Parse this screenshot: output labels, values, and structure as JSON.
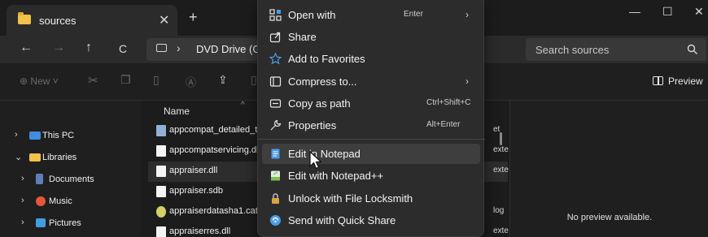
{
  "window": {
    "tab_title": "sources",
    "tab_close": "✕",
    "new_tab": "+",
    "minimize": "—",
    "maximize": "☐",
    "close": "✕"
  },
  "navigation": {
    "back": "←",
    "forward": "→",
    "up": "↑",
    "refresh": "C",
    "separator": "›",
    "address": "DVD Drive (G:)",
    "search_placeholder": "Search sources",
    "search_icon": "search-icon"
  },
  "commandbar": {
    "new_label": "New",
    "preview_label": "Preview",
    "icons": [
      "cut-icon",
      "copy-icon",
      "paste-icon",
      "rename-icon",
      "share-icon",
      "delete-icon"
    ]
  },
  "sidebar": {
    "items": [
      {
        "label": "This PC",
        "chevron": "›",
        "icon": "monitor-icon",
        "color": "#3f8ede"
      },
      {
        "label": "Libraries",
        "chevron": "⌄",
        "icon": "folder-icon",
        "color": "#f3c24a"
      },
      {
        "label": "Documents",
        "chevron": "›",
        "icon": "documents-icon",
        "color": "#5d7fb5"
      },
      {
        "label": "Music",
        "chevron": "›",
        "icon": "music-icon",
        "color": "#e4573a"
      },
      {
        "label": "Pictures",
        "chevron": "›",
        "icon": "pictures-icon",
        "color": "#3f9ede"
      }
    ]
  },
  "filelist": {
    "column_name": "Name",
    "sort_caret": "^",
    "files": [
      {
        "name": "appcompat_detailed_tx",
        "type": "et",
        "icon": "config-file-icon",
        "selected": false
      },
      {
        "name": "appcompatservicing.dll",
        "type": "exte",
        "icon": "file-icon",
        "selected": false
      },
      {
        "name": "appraiser.dll",
        "type": "exte",
        "icon": "file-icon",
        "selected": true
      },
      {
        "name": "appraiser.sdb",
        "type": "",
        "icon": "file-icon",
        "selected": false
      },
      {
        "name": "appraiserdatasha1.cat",
        "type": "log",
        "icon": "catalog-file-icon",
        "selected": false
      },
      {
        "name": "appraiserres.dll",
        "type": "exte",
        "icon": "file-icon",
        "selected": false
      }
    ]
  },
  "preview": {
    "message": "No preview available."
  },
  "context_menu": {
    "items": [
      {
        "label": "Open with",
        "shortcut": "Enter",
        "submenu": true,
        "icon": "open-with-icon",
        "highlighted": false
      },
      {
        "label": "Share",
        "shortcut": "",
        "submenu": false,
        "icon": "share-icon",
        "highlighted": false
      },
      {
        "label": "Add to Favorites",
        "shortcut": "",
        "submenu": false,
        "icon": "star-icon",
        "highlighted": false
      },
      {
        "label": "Compress to...",
        "shortcut": "",
        "submenu": true,
        "icon": "compress-icon",
        "highlighted": false
      },
      {
        "label": "Copy as path",
        "shortcut": "Ctrl+Shift+C",
        "submenu": false,
        "icon": "copy-path-icon",
        "highlighted": false
      },
      {
        "label": "Properties",
        "shortcut": "Alt+Enter",
        "submenu": false,
        "icon": "wrench-icon",
        "highlighted": false
      },
      {
        "label": "Edit in Notepad",
        "shortcut": "",
        "submenu": false,
        "icon": "notepad-icon",
        "highlighted": true
      },
      {
        "label": "Edit with Notepad++",
        "shortcut": "",
        "submenu": false,
        "icon": "notepad-plus-plus-icon",
        "highlighted": false
      },
      {
        "label": "Unlock with File Locksmith",
        "shortcut": "",
        "submenu": false,
        "icon": "lock-icon",
        "highlighted": false
      },
      {
        "label": "Send with Quick Share",
        "shortcut": "",
        "submenu": false,
        "icon": "quick-share-icon",
        "highlighted": false
      }
    ],
    "submenu_arrow": "›"
  },
  "colors": {
    "accent": "#4c9be8",
    "menu_bg": "#2c2c2c",
    "highlight": "#3e3e3e",
    "window_bg": "#1c1c1c"
  }
}
